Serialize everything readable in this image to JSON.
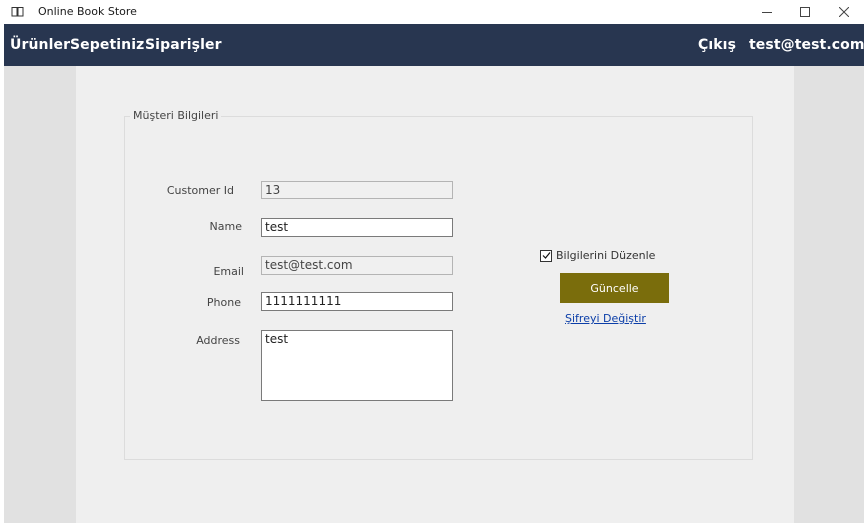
{
  "window": {
    "title": "Online Book Store",
    "app_icon": "book-icon",
    "controls": {
      "minimize": "—",
      "maximize": "☐",
      "close": "✕"
    }
  },
  "nav": {
    "items": [
      "Ürünler",
      "Sepetiniz",
      "Siparişler"
    ],
    "logout": "Çıkış",
    "user": "test@test.com"
  },
  "group": {
    "title": "Müşteri Bilgileri"
  },
  "form": {
    "customer_id": {
      "label": "Customer Id",
      "value": "13"
    },
    "name": {
      "label": "Name",
      "value": "test"
    },
    "email": {
      "label": "Email",
      "value": "test@test.com"
    },
    "phone": {
      "label": "Phone",
      "value": "1111111111"
    },
    "address": {
      "label": "Address",
      "value": "test"
    }
  },
  "actions": {
    "edit_checkbox_label": "Bilgilerini Düzenle",
    "edit_checked": true,
    "update_button": "Güncelle",
    "change_password_link": "Şifreyi Değiştir"
  },
  "colors": {
    "navbar": "#283650",
    "update_button": "#7a6d0c",
    "link": "#0b3ea8"
  }
}
